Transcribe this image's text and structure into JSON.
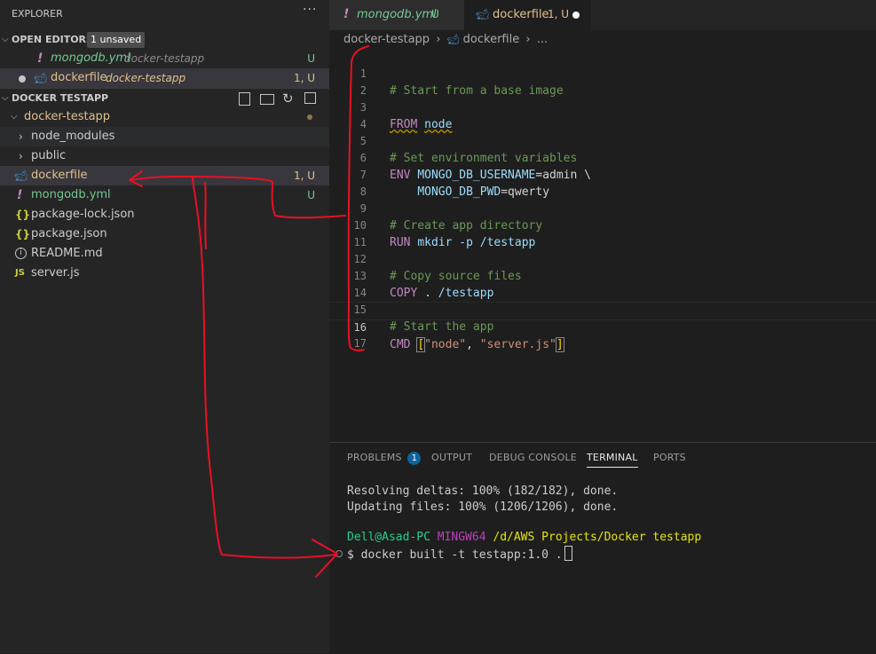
{
  "explorer": {
    "title": "EXPLORER",
    "more_icon": "ellipsis-icon",
    "open_editors": {
      "label": "OPEN EDITORS",
      "unsaved_badge": "1 unsaved",
      "items": [
        {
          "name": "mongodb.yml",
          "folder": "docker-testapp",
          "status": "U",
          "icon": "yaml-exclamation-icon"
        },
        {
          "name": "dockerfile",
          "folder": "docker-testapp",
          "status": "1, U",
          "icon": "docker-whale-icon"
        }
      ]
    },
    "workspace": {
      "label": "DOCKER TESTAPP",
      "actions": [
        "new-file-icon",
        "new-folder-icon",
        "refresh-icon",
        "collapse-all-icon"
      ],
      "root_folder": "docker-testapp",
      "items": [
        {
          "name": "node_modules",
          "type": "folder"
        },
        {
          "name": "public",
          "type": "folder"
        },
        {
          "name": "dockerfile",
          "type": "file",
          "status": "1, U"
        },
        {
          "name": "mongodb.yml",
          "type": "file",
          "status": "U"
        },
        {
          "name": "package-lock.json",
          "type": "file"
        },
        {
          "name": "package.json",
          "type": "file"
        },
        {
          "name": "README.md",
          "type": "file"
        },
        {
          "name": "server.js",
          "type": "file"
        }
      ]
    }
  },
  "tabs": [
    {
      "name": "mongodb.yml",
      "status": "U"
    },
    {
      "name": "dockerfile",
      "status": "1, U"
    }
  ],
  "breadcrumb": {
    "folder": "docker-testapp",
    "file": "dockerfile",
    "more": "..."
  },
  "code_lines": [
    {
      "n": "1",
      "text": "# Start from a base image"
    },
    {
      "n": "2",
      "text": ""
    },
    {
      "n": "3",
      "kw": "FROM",
      "rest": "node"
    },
    {
      "n": "4",
      "text": ""
    },
    {
      "n": "5",
      "text": "# Set environment variables"
    },
    {
      "n": "6",
      "kw": "ENV",
      "var": "MONGO_DB_USERNAME",
      "rest": "=admin \\"
    },
    {
      "n": "7",
      "indent": "    ",
      "var": "MONGO_DB_PWD",
      "rest": "=qwerty"
    },
    {
      "n": "8",
      "text": ""
    },
    {
      "n": "9",
      "text": "# Create app directory"
    },
    {
      "n": "10",
      "kw": "RUN",
      "rest": "mkdir -p /testapp"
    },
    {
      "n": "11",
      "text": ""
    },
    {
      "n": "12",
      "text": "# Copy source files"
    },
    {
      "n": "13",
      "kw": "COPY",
      "rest": ". /testapp"
    },
    {
      "n": "14",
      "text": ""
    },
    {
      "n": "15",
      "text": "# Start the app"
    },
    {
      "n": "16",
      "kw": "CMD",
      "open": "[",
      "s1": "\"node\"",
      "comma": ", ",
      "s2": "\"server.js\"",
      "close": "]"
    },
    {
      "n": "17",
      "text": ""
    }
  ],
  "panel": {
    "tabs": [
      "PROBLEMS",
      "OUTPUT",
      "DEBUG CONSOLE",
      "TERMINAL",
      "PORTS"
    ],
    "problems_count": "1",
    "active_tab": "TERMINAL",
    "terminal": {
      "line1": "Resolving deltas: 100% (182/182), done.",
      "line2": "Updating files: 100% (1206/1206), done.",
      "prompt_user": "Dell@Asad-PC",
      "prompt_shell": "MINGW64",
      "prompt_path": "/d/AWS Projects/Docker testapp",
      "command": "$ docker built -t testapp:1.0 ."
    }
  },
  "colors": {
    "accent_yellow": "#e2c08d",
    "untracked_green": "#73c991",
    "annotation_red": "#e81123"
  }
}
